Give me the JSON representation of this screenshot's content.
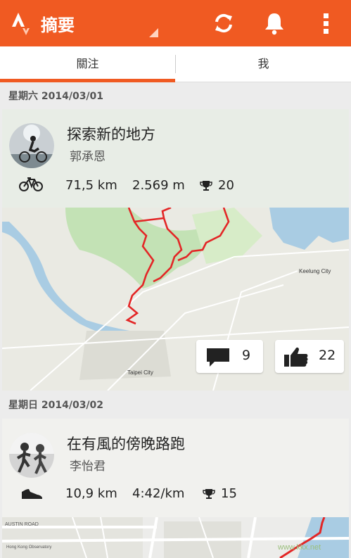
{
  "app": {
    "title": "摘要"
  },
  "tabs": [
    {
      "label": "關注",
      "active": true
    },
    {
      "label": "我",
      "active": false
    }
  ],
  "colors": {
    "accent": "#f05a22",
    "route": "#e32626"
  },
  "feed": [
    {
      "date": "星期六 2014/03/01",
      "title": "探索新的地方",
      "athlete": "郭承恩",
      "sport_icon": "bicycle-icon",
      "distance": "71,5 km",
      "elevation": "2.569 m",
      "achievements": "20",
      "map_labels": [
        "Keelung City",
        "Taipei City"
      ],
      "comments": "9",
      "kudos": "22"
    },
    {
      "date": "星期日 2014/03/02",
      "title": "在有風的傍晚路跑",
      "athlete": "李怡君",
      "sport_icon": "running-shoe-icon",
      "distance": "10,9 km",
      "pace": "4:42/km",
      "achievements": "15",
      "map_labels": [
        "AUSTIN ROAD",
        "Hong Kong Observatory"
      ]
    }
  ],
  "watermark": "www.kkx.net"
}
